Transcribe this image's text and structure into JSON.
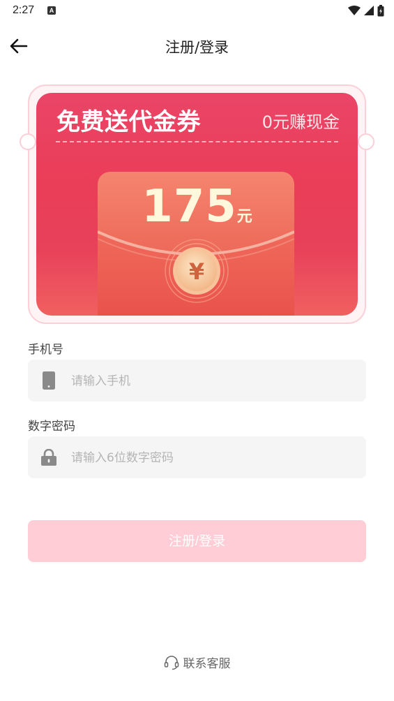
{
  "status_bar": {
    "time": "2:27",
    "notification_letter": "A"
  },
  "header": {
    "title": "注册/登录"
  },
  "banner": {
    "title": "免费送代金券",
    "subtitle": "0元赚现金",
    "amount": "175",
    "unit": "元",
    "coin_symbol": "¥"
  },
  "form": {
    "phone_label": "手机号",
    "phone_placeholder": "请输入手机",
    "phone_value": "",
    "password_label": "数字密码",
    "password_placeholder": "请输入6位数字密码",
    "password_value": ""
  },
  "submit_label": "注册/登录",
  "footer": {
    "service_label": "联系客服"
  },
  "colors": {
    "accent_red": "#ea3d58",
    "button_disabled": "#ffcdd5",
    "input_bg": "#f5f5f5"
  }
}
